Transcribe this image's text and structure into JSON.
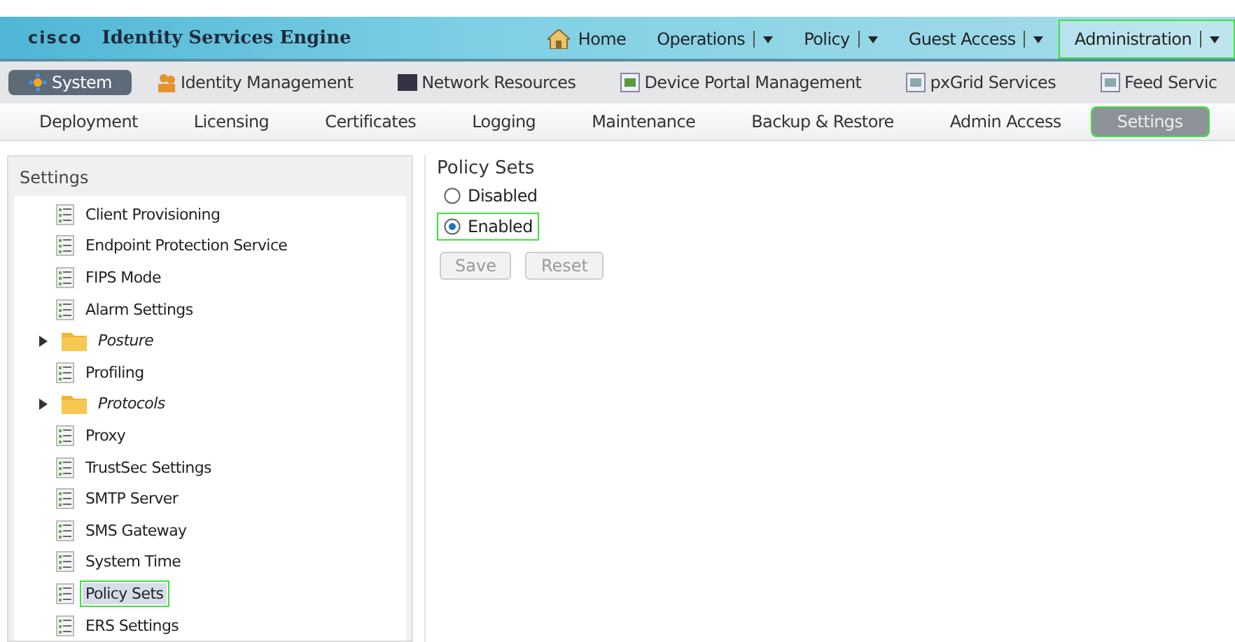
{
  "header": {
    "logo": "cisco",
    "title": "Identity Services Engine",
    "nav": [
      {
        "label": "Home",
        "kind": "home",
        "selected": false,
        "highlighted": false
      },
      {
        "label": "Operations",
        "kind": "menu",
        "selected": false,
        "highlighted": false
      },
      {
        "label": "Policy",
        "kind": "menu",
        "selected": false,
        "highlighted": false
      },
      {
        "label": "Guest Access",
        "kind": "menu",
        "selected": false,
        "highlighted": false
      },
      {
        "label": "Administration",
        "kind": "menu",
        "selected": true,
        "highlighted": true
      }
    ]
  },
  "sections": [
    {
      "label": "System",
      "selected": true
    },
    {
      "label": "Identity Management",
      "selected": false
    },
    {
      "label": "Network Resources",
      "selected": false
    },
    {
      "label": "Device Portal Management",
      "selected": false
    },
    {
      "label": "pxGrid Services",
      "selected": false
    },
    {
      "label": "Feed Servic",
      "selected": false
    }
  ],
  "tabs": [
    {
      "label": "Deployment",
      "selected": false,
      "highlighted": false
    },
    {
      "label": "Licensing",
      "selected": false,
      "highlighted": false
    },
    {
      "label": "Certificates",
      "selected": false,
      "highlighted": false
    },
    {
      "label": "Logging",
      "selected": false,
      "highlighted": false
    },
    {
      "label": "Maintenance",
      "selected": false,
      "highlighted": false
    },
    {
      "label": "Backup & Restore",
      "selected": false,
      "highlighted": false
    },
    {
      "label": "Admin Access",
      "selected": false,
      "highlighted": false
    },
    {
      "label": "Settings",
      "selected": true,
      "highlighted": true
    }
  ],
  "sidebar": {
    "title": "Settings",
    "items": [
      {
        "label": "Client Provisioning",
        "kind": "leaf",
        "selected": false
      },
      {
        "label": "Endpoint Protection Service",
        "kind": "leaf",
        "selected": false
      },
      {
        "label": "FIPS Mode",
        "kind": "leaf",
        "selected": false
      },
      {
        "label": "Alarm Settings",
        "kind": "leaf",
        "selected": false
      },
      {
        "label": "Posture",
        "kind": "folder",
        "expanded": false,
        "selected": false
      },
      {
        "label": "Profiling",
        "kind": "leaf",
        "selected": false
      },
      {
        "label": "Protocols",
        "kind": "folder",
        "expanded": false,
        "selected": false
      },
      {
        "label": "Proxy",
        "kind": "leaf",
        "selected": false
      },
      {
        "label": "TrustSec Settings",
        "kind": "leaf",
        "selected": false
      },
      {
        "label": "SMTP Server",
        "kind": "leaf",
        "selected": false
      },
      {
        "label": "SMS Gateway",
        "kind": "leaf",
        "selected": false
      },
      {
        "label": "System Time",
        "kind": "leaf",
        "selected": false
      },
      {
        "label": "Policy Sets",
        "kind": "leaf",
        "selected": true
      },
      {
        "label": "ERS Settings",
        "kind": "leaf",
        "selected": false
      }
    ]
  },
  "content": {
    "title": "Policy Sets",
    "options": [
      {
        "label": "Disabled",
        "selected": false,
        "highlighted": false
      },
      {
        "label": "Enabled",
        "selected": true,
        "highlighted": true
      }
    ],
    "buttons": [
      {
        "label": "Save",
        "disabled": true
      },
      {
        "label": "Reset",
        "disabled": true
      }
    ]
  }
}
